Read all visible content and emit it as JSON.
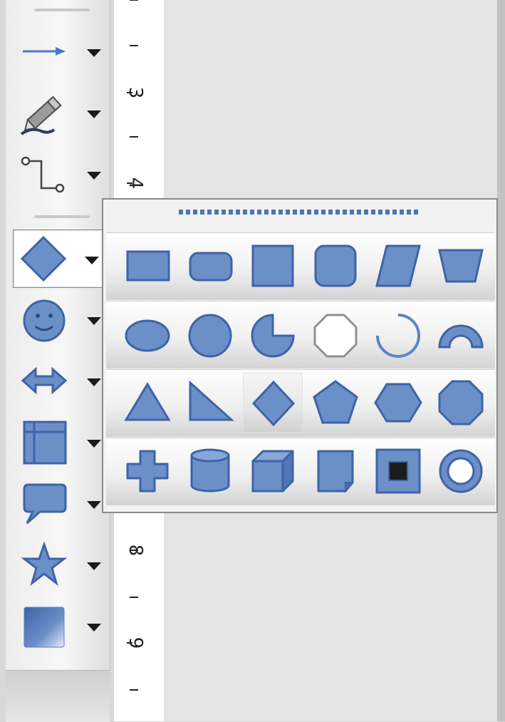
{
  "colors": {
    "shape_fill": "#6b8fc7",
    "shape_stroke": "#3e63a8",
    "toolbar_bg": "#f1f1f1",
    "canvas_bg": "#e4e4e4"
  },
  "toolbar": {
    "tools": [
      {
        "name": "line-arrow",
        "icon": "arrow-icon"
      },
      {
        "name": "freehand",
        "icon": "pencil-icon"
      },
      {
        "name": "connector",
        "icon": "connector-icon"
      },
      {
        "name": "basic-shapes",
        "icon": "diamond-icon",
        "active": true
      },
      {
        "name": "symbol-shapes",
        "icon": "smiley-icon"
      },
      {
        "name": "block-arrows",
        "icon": "double-arrow-icon"
      },
      {
        "name": "flowchart",
        "icon": "flowchart-icon"
      },
      {
        "name": "callouts",
        "icon": "callout-icon"
      },
      {
        "name": "stars",
        "icon": "star-icon"
      },
      {
        "name": "3d-objects",
        "icon": "cube-gradient-icon"
      }
    ]
  },
  "ruler": {
    "labels": [
      "3",
      "4",
      "8",
      "9"
    ]
  },
  "basic_shapes_popup": {
    "rows": [
      [
        "rectangle-icon",
        "rounded-rectangle-icon",
        "square-icon",
        "rounded-square-icon",
        "parallelogram-icon",
        "trapezoid-icon"
      ],
      [
        "ellipse-icon",
        "circle-icon",
        "circle-pie-icon",
        "octagon-circle-icon",
        "arc-icon",
        "block-arc-icon"
      ],
      [
        "isosceles-triangle-icon",
        "right-triangle-icon",
        "diamond-icon",
        "pentagon-icon",
        "hexagon-icon",
        "octagon-icon"
      ],
      [
        "cross-icon",
        "cylinder-icon",
        "cube-icon",
        "folded-corner-icon",
        "frame-icon",
        "ring-icon"
      ]
    ]
  }
}
